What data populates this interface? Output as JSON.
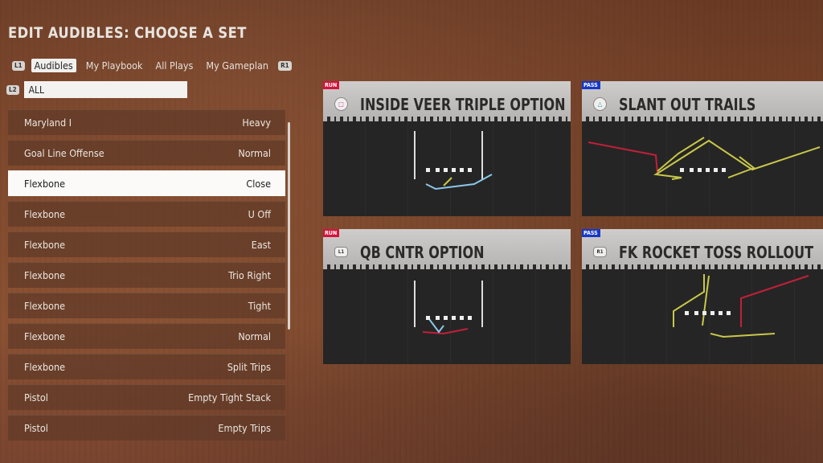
{
  "title": "EDIT AUDIBLES: CHOOSE A SET",
  "tabs": {
    "left_button": "L1",
    "right_button": "R1",
    "items": [
      {
        "label": "Audibles",
        "active": true
      },
      {
        "label": "My Playbook",
        "active": false
      },
      {
        "label": "All Plays",
        "active": false
      },
      {
        "label": "My Gameplan",
        "active": false
      }
    ]
  },
  "filter": {
    "button": "L2",
    "value": "ALL"
  },
  "formations": [
    {
      "name": "Maryland I",
      "set": "Heavy"
    },
    {
      "name": "Goal Line Offense",
      "set": "Normal"
    },
    {
      "name": "Flexbone",
      "set": "Close",
      "selected": true
    },
    {
      "name": "Flexbone",
      "set": "U Off"
    },
    {
      "name": "Flexbone",
      "set": "East"
    },
    {
      "name": "Flexbone",
      "set": "Trio Right"
    },
    {
      "name": "Flexbone",
      "set": "Tight"
    },
    {
      "name": "Flexbone",
      "set": "Normal"
    },
    {
      "name": "Flexbone",
      "set": "Split Trips"
    },
    {
      "name": "Pistol",
      "set": "Empty Tight Stack"
    },
    {
      "name": "Pistol",
      "set": "Empty Trips"
    }
  ],
  "plays": [
    {
      "type": "RUN",
      "button": "square",
      "button_glyph": "□",
      "button_color": "#c040a0",
      "name": "INSIDE VEER TRIPLE OPTION"
    },
    {
      "type": "PASS",
      "button": "triangle",
      "button_glyph": "△",
      "button_color": "#20a0a0",
      "name": "SLANT OUT TRAILS"
    },
    {
      "type": "RUN",
      "button": "L1",
      "button_glyph": "L1",
      "button_color": "#333333",
      "name": "QB CNTR OPTION"
    },
    {
      "type": "PASS",
      "button": "R1",
      "button_glyph": "R1",
      "button_color": "#333333",
      "name": "FK ROCKET TOSS ROLLOUT"
    }
  ],
  "colors": {
    "run": "#d4143c",
    "pass": "#1638c8",
    "route_yellow": "#c8c84a",
    "route_red": "#c0203a",
    "route_blue": "#8ac8e8"
  }
}
